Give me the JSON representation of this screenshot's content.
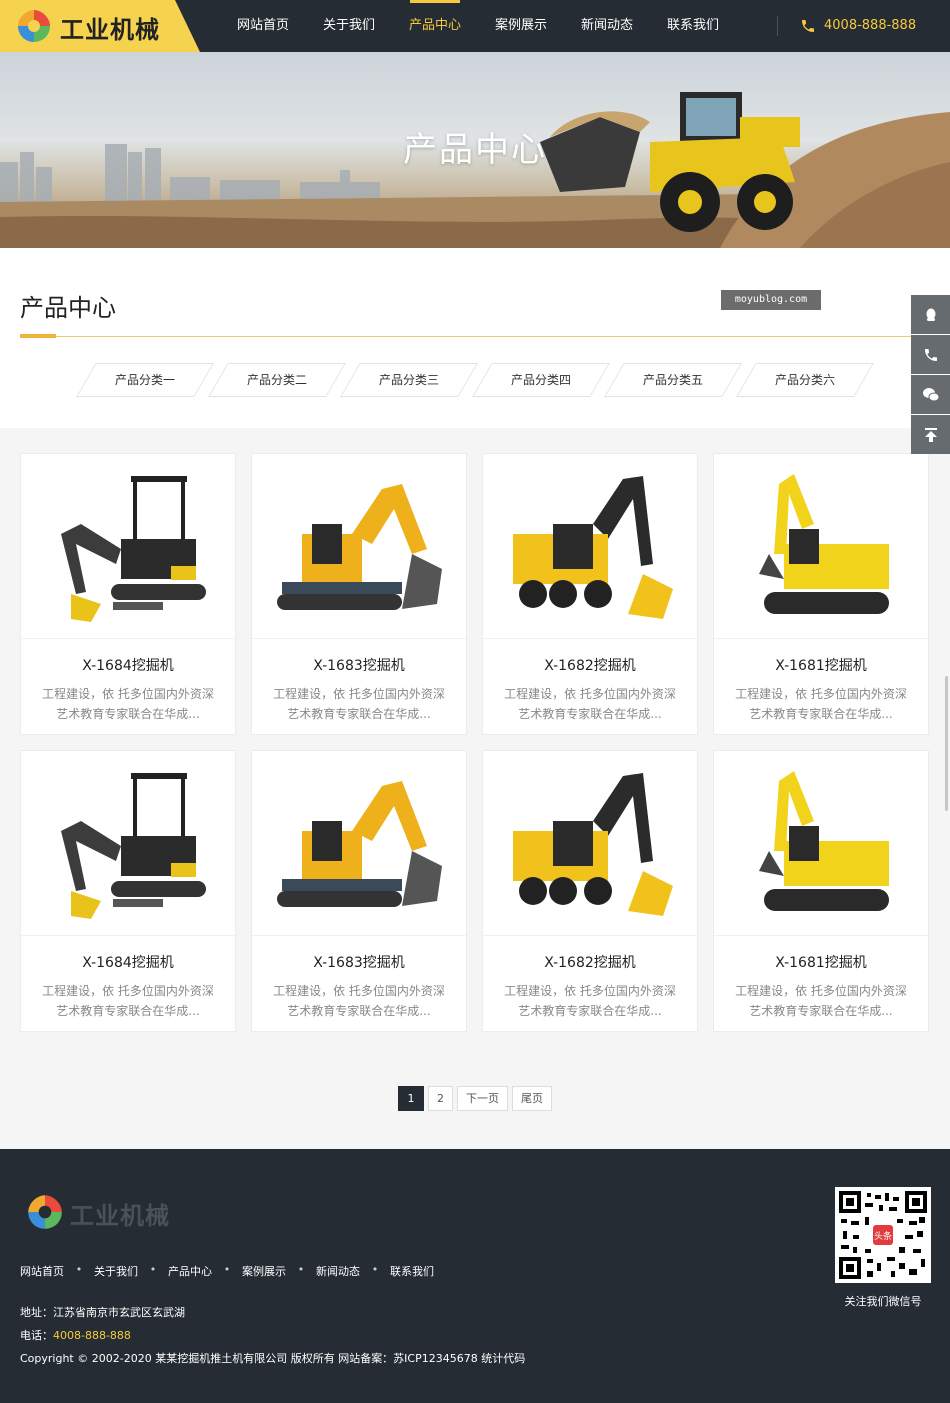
{
  "header": {
    "logo_text": "工业机械",
    "nav": [
      {
        "label": "网站首页",
        "active": false
      },
      {
        "label": "关于我们",
        "active": false
      },
      {
        "label": "产品中心",
        "active": true
      },
      {
        "label": "案例展示",
        "active": false
      },
      {
        "label": "新闻动态",
        "active": false
      },
      {
        "label": "联系我们",
        "active": false
      }
    ],
    "phone": "4008-888-888"
  },
  "banner": {
    "title": "产品中心"
  },
  "section": {
    "title": "产品中心",
    "watermark": "moyublog.com",
    "categories": [
      "产品分类一",
      "产品分类二",
      "产品分类三",
      "产品分类四",
      "产品分类五",
      "产品分类六"
    ]
  },
  "products": [
    {
      "title": "X-1684挖掘机",
      "desc1": "工程建设，依 托多位国内外资深",
      "desc2": "艺术教育专家联合在华成...",
      "style": "mini-deere"
    },
    {
      "title": "X-1683挖掘机",
      "desc1": "工程建设，依 托多位国内外资深",
      "desc2": "艺术教育专家联合在华成...",
      "style": "gehl"
    },
    {
      "title": "X-1682挖掘机",
      "desc1": "工程建设，依 托多位国内外资深",
      "desc2": "艺术教育专家联合在华成...",
      "style": "wheeled"
    },
    {
      "title": "X-1681挖掘机",
      "desc1": "工程建设，依 托多位国内外资深",
      "desc2": "艺术教育专家联合在华成...",
      "style": "komatsu"
    },
    {
      "title": "X-1684挖掘机",
      "desc1": "工程建设，依 托多位国内外资深",
      "desc2": "艺术教育专家联合在华成...",
      "style": "mini-deere"
    },
    {
      "title": "X-1683挖掘机",
      "desc1": "工程建设，依 托多位国内外资深",
      "desc2": "艺术教育专家联合在华成...",
      "style": "gehl"
    },
    {
      "title": "X-1682挖掘机",
      "desc1": "工程建设，依 托多位国内外资深",
      "desc2": "艺术教育专家联合在华成...",
      "style": "wheeled"
    },
    {
      "title": "X-1681挖掘机",
      "desc1": "工程建设，依 托多位国内外资深",
      "desc2": "艺术教育专家联合在华成...",
      "style": "komatsu"
    }
  ],
  "pagination": [
    {
      "label": "1",
      "active": true
    },
    {
      "label": "2",
      "active": false
    },
    {
      "label": "下一页",
      "active": false
    },
    {
      "label": "尾页",
      "active": false
    }
  ],
  "side_tools": [
    "qq-icon",
    "phone-icon",
    "wechat-icon",
    "back-to-top-icon"
  ],
  "footer": {
    "logo_text": "工业机械",
    "nav": [
      "网站首页",
      "关于我们",
      "产品中心",
      "案例展示",
      "新闻动态",
      "联系我们"
    ],
    "address_label": "地址：",
    "address": "江苏省南京市玄武区玄武湖",
    "phone_label": "电话：",
    "phone": "4008-888-888",
    "copyright": "Copyright © 2002-2020 某某挖掘机推土机有限公司 版权所有 网站备案：苏ICP12345678 统计代码",
    "qr_label": "关注我们微信号",
    "qr_badge": "头条"
  },
  "colors": {
    "accent": "#f6c93e",
    "dark": "#252c33"
  }
}
